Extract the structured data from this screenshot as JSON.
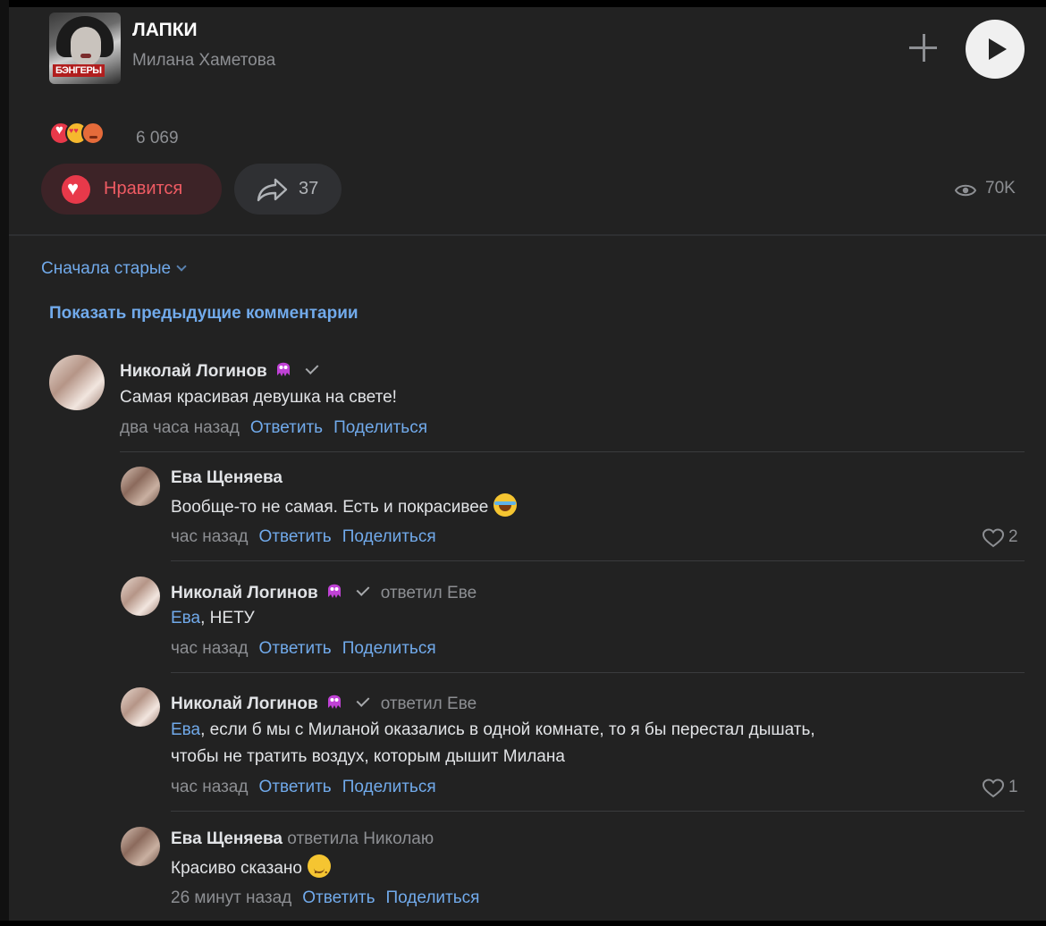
{
  "track": {
    "title": "ЛАПКИ",
    "artist": "Милана Хаметова",
    "cover_tag": "БЭНГЕРЫ"
  },
  "icons": {
    "add": "plus-icon",
    "play": "play-icon",
    "like": "heart-icon",
    "share": "share-arrow-icon",
    "views": "eye-icon",
    "verified": "check-icon",
    "badge": "purple-monster-icon"
  },
  "colors": {
    "background": "#222222",
    "accent": "#71aaeb",
    "like": "#e8394a",
    "muted": "#8d8f93"
  },
  "reactions": {
    "count": "6 069"
  },
  "actions": {
    "like_label": "Нравится",
    "share_count": "37",
    "views_count": "70K"
  },
  "comments_section": {
    "sort_label": "Сначала старые",
    "show_previous": "Показать предыдущие комментарии"
  },
  "reply_label": "Ответить",
  "share_label": "Поделиться",
  "comments": [
    {
      "author": "Николай Логинов",
      "text": "Самая красивая девушка на свете!",
      "time": "два часа назад"
    },
    {
      "author": "Ева Щеняева",
      "text": "Вообще-то не самая. Есть и покрасивее",
      "time": "час назад",
      "likes": "2"
    },
    {
      "author": "Николай Логинов",
      "reply_to": "ответил Еве",
      "mention": "Ева",
      "text": ", НЕТУ",
      "time": "час назад"
    },
    {
      "author": "Николай Логинов",
      "reply_to": "ответил Еве",
      "mention": "Ева",
      "text_line1": ", если б мы с Миланой оказались в одной комнате, то я бы перестал дышать,",
      "text_line2": "чтобы не тратить воздух, которым дышит Милана",
      "time": "час назад",
      "likes": "1"
    },
    {
      "author": "Ева Щеняева",
      "reply_to": "ответила Николаю",
      "text": "Красиво сказано",
      "time": "26 минут назад"
    }
  ]
}
